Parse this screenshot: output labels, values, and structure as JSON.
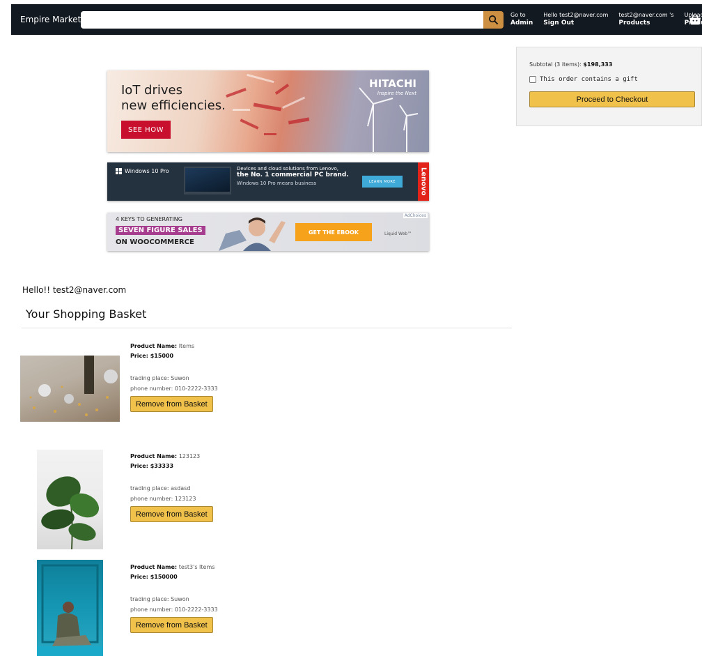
{
  "header": {
    "brand": "Empire Market",
    "search": {
      "value": "",
      "placeholder": ""
    },
    "nav": [
      {
        "line1": "Go to",
        "line2": "Admin"
      },
      {
        "line1": "Hello test2@naver.com",
        "line2": "Sign Out"
      },
      {
        "line1": "test2@naver.com 's",
        "line2": "Products"
      },
      {
        "line1": "Upload",
        "line2": "Product"
      }
    ],
    "search_icon": "search-icon",
    "basket_icon": "shopping-basket-icon"
  },
  "subtotal": {
    "label": "Subtotal (3 items):",
    "amount": "$198,333",
    "gift_label": "This order contains a gift",
    "gift_checked": false,
    "checkout_label": "Proceed to Checkout"
  },
  "ads": {
    "ad1": {
      "headline_1": "IoT drives",
      "headline_2": "new efficiencies.",
      "cta": "SEE HOW",
      "brand": "HITACHI",
      "tagline": "Inspire the Next"
    },
    "ad2": {
      "os": "Windows 10 Pro",
      "copy_1": "Devices and cloud solutions from Lenovo,",
      "copy_2": "the No. 1 commercial PC brand.",
      "copy_3": "Windows 10 Pro means business",
      "cta": "LEARN MORE",
      "brand": "Lenovo"
    },
    "ad3": {
      "line_1": "4 KEYS TO GENERATING",
      "line_2": "SEVEN FIGURE SALES",
      "line_3": "ON WOOCOMMERCE",
      "cta": "GET THE EBOOK",
      "brand": "Liquid Web™",
      "adchoices": "AdChoices"
    }
  },
  "greeting": "Hello!! test2@naver.com",
  "basket_title": "Your Shopping Basket",
  "items": [
    {
      "name_label": "Product Name:",
      "name": "Items",
      "price_label": "Price:",
      "price": "$15000",
      "place_label": "trading place:",
      "place": "Suwon",
      "phone_label": "phone number:",
      "phone": "010-2222-3333",
      "remove_label": "Remove from Basket"
    },
    {
      "name_label": "Product Name:",
      "name": "123123",
      "price_label": "Price:",
      "price": "$33333",
      "place_label": "trading place:",
      "place": "asdasd",
      "phone_label": "phone number:",
      "phone": "123123",
      "remove_label": "Remove from Basket"
    },
    {
      "name_label": "Product Name:",
      "name": "test3's Items",
      "price_label": "Price:",
      "price": "$150000",
      "place_label": "trading place:",
      "place": "Suwon",
      "phone_label": "phone number:",
      "phone": "010-2222-3333",
      "remove_label": "Remove from Basket"
    }
  ],
  "colors": {
    "header_bg": "#131921",
    "search_button": "#cd9042",
    "button_yellow": "#f0c14b",
    "button_border": "#a88734"
  }
}
